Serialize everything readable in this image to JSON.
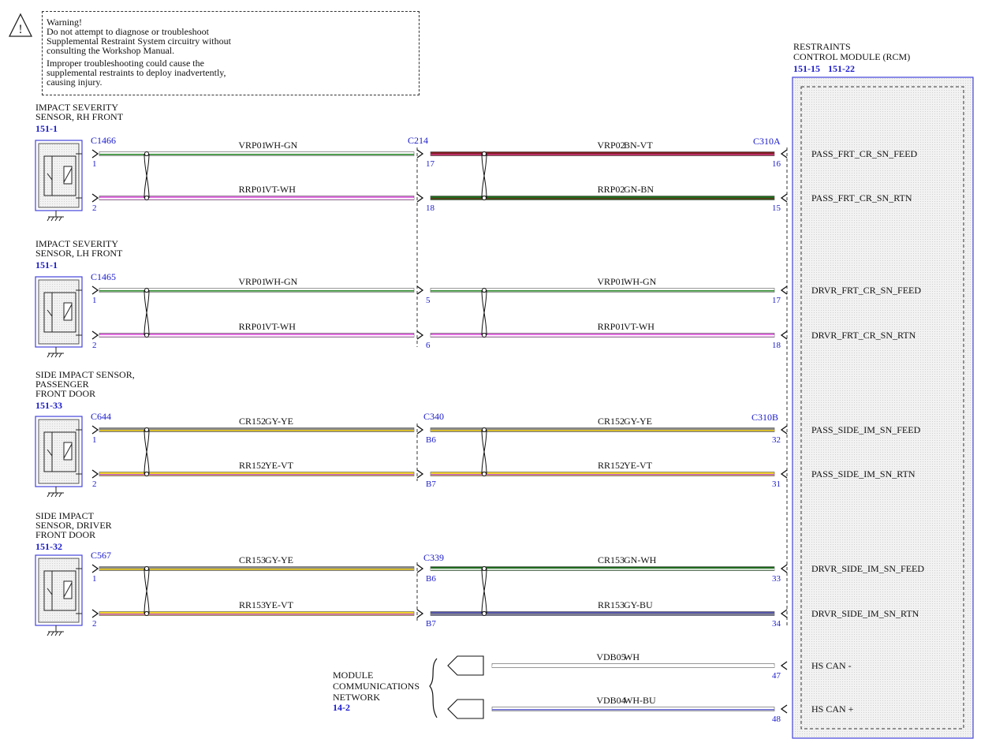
{
  "warning": {
    "lines": [
      "Warning!",
      "Do not attempt to diagnose or troubleshoot",
      "Supplemental Restraint System circuitry without",
      "consulting the Workshop Manual.",
      "Improper troubleshooting could cause the",
      "supplemental restraints to deploy inadvertently,",
      "causing injury."
    ]
  },
  "module": {
    "title_lines": [
      "RESTRAINTS",
      "CONTROL MODULE (RCM)"
    ],
    "refs": [
      "151-15",
      "151-22"
    ]
  },
  "sensors": [
    {
      "name_lines": [
        "IMPACT SEVERITY",
        "SENSOR, RH FRONT"
      ],
      "ref": "151-1",
      "connector": "C1466",
      "pins": [
        "1",
        "2"
      ]
    },
    {
      "name_lines": [
        "IMPACT SEVERITY",
        "SENSOR, LH FRONT"
      ],
      "ref": "151-1",
      "connector": "C1465",
      "pins": [
        "1",
        "2"
      ]
    },
    {
      "name_lines": [
        "SIDE IMPACT SENSOR,",
        "PASSENGER",
        "FRONT DOOR"
      ],
      "ref": "151-33",
      "connector": "C644",
      "pins": [
        "1",
        "2"
      ]
    },
    {
      "name_lines": [
        "SIDE IMPACT",
        "SENSOR, DRIVER",
        "FRONT DOOR"
      ],
      "ref": "151-32",
      "connector": "C567",
      "pins": [
        "1",
        "2"
      ]
    }
  ],
  "inline_connectors": [
    "C214",
    "C340",
    "C339"
  ],
  "module_connectors": [
    "C310A",
    "C310B"
  ],
  "circuits": [
    {
      "left_circuit": "VRP01",
      "left_color": "WH-GN",
      "left_hex": [
        "#ffffff",
        "#2e8b2e"
      ],
      "inline_pin": "17",
      "right_circuit": "VRP02",
      "right_color": "BN-VT",
      "right_hex": [
        "#7b1c1c",
        "#c8327a"
      ],
      "module_pin": "16",
      "signal": "PASS_FRT_CR_SN_FEED"
    },
    {
      "left_circuit": "RRP01",
      "left_color": "VT-WH",
      "left_hex": [
        "#e070e0",
        "#ffffff"
      ],
      "inline_pin": "18",
      "right_circuit": "RRP02",
      "right_color": "GN-BN",
      "right_hex": [
        "#1f6b1f",
        "#5a3a1a"
      ],
      "module_pin": "15",
      "signal": "PASS_FRT_CR_SN_RTN"
    },
    {
      "left_circuit": "VRP01",
      "left_color": "WH-GN",
      "left_hex": [
        "#ffffff",
        "#2e8b2e"
      ],
      "inline_pin": "5",
      "right_circuit": "VRP01",
      "right_color": "WH-GN",
      "right_hex": [
        "#ffffff",
        "#2e8b2e"
      ],
      "module_pin": "17",
      "signal": "DRVR_FRT_CR_SN_FEED"
    },
    {
      "left_circuit": "RRP01",
      "left_color": "VT-WH",
      "left_hex": [
        "#e070e0",
        "#ffffff"
      ],
      "inline_pin": "6",
      "right_circuit": "RRP01",
      "right_color": "VT-WH",
      "right_hex": [
        "#e070e0",
        "#ffffff"
      ],
      "module_pin": "18",
      "signal": "DRVR_FRT_CR_SN_RTN"
    },
    {
      "left_circuit": "CR152",
      "left_color": "GY-YE",
      "left_hex": [
        "#8a8a8a",
        "#e6c619"
      ],
      "inline_pin": "B6",
      "right_circuit": "CR152",
      "right_color": "GY-YE",
      "right_hex": [
        "#8a8a8a",
        "#e6c619"
      ],
      "module_pin": "32",
      "signal": "PASS_SIDE_IM_SN_FEED"
    },
    {
      "left_circuit": "RR152",
      "left_color": "YE-VT",
      "left_hex": [
        "#f2d22e",
        "#c060c0"
      ],
      "inline_pin": "B7",
      "right_circuit": "RR152",
      "right_color": "YE-VT",
      "right_hex": [
        "#f2d22e",
        "#c060c0"
      ],
      "module_pin": "31",
      "signal": "PASS_SIDE_IM_SN_RTN"
    },
    {
      "left_circuit": "CR153",
      "left_color": "GY-YE",
      "left_hex": [
        "#8a8a8a",
        "#e6c619"
      ],
      "inline_pin": "B6",
      "right_circuit": "CR153",
      "right_color": "GN-WH",
      "right_hex": [
        "#1f6b1f",
        "#ffffff"
      ],
      "module_pin": "33",
      "signal": "DRVR_SIDE_IM_SN_FEED"
    },
    {
      "left_circuit": "RR153",
      "left_color": "YE-VT",
      "left_hex": [
        "#f2d22e",
        "#c060c0"
      ],
      "inline_pin": "B7",
      "right_circuit": "RR153",
      "right_color": "GY-BU",
      "right_hex": [
        "#5555aa",
        "#8a8a8a"
      ],
      "module_pin": "34",
      "signal": "DRVR_SIDE_IM_SN_RTN"
    }
  ],
  "network": {
    "name_lines": [
      "MODULE",
      "COMMUNICATIONS",
      "NETWORK"
    ],
    "ref": "14-2",
    "lines": [
      {
        "circuit": "VDB05",
        "color": "WH",
        "hex": [
          "#ffffff",
          "#ffffff"
        ],
        "module_pin": "47",
        "signal": "HS CAN -"
      },
      {
        "circuit": "VDB04",
        "color": "WH-BU",
        "hex": [
          "#ffffff",
          "#6a6ad0"
        ],
        "module_pin": "48",
        "signal": "HS CAN +"
      }
    ]
  }
}
